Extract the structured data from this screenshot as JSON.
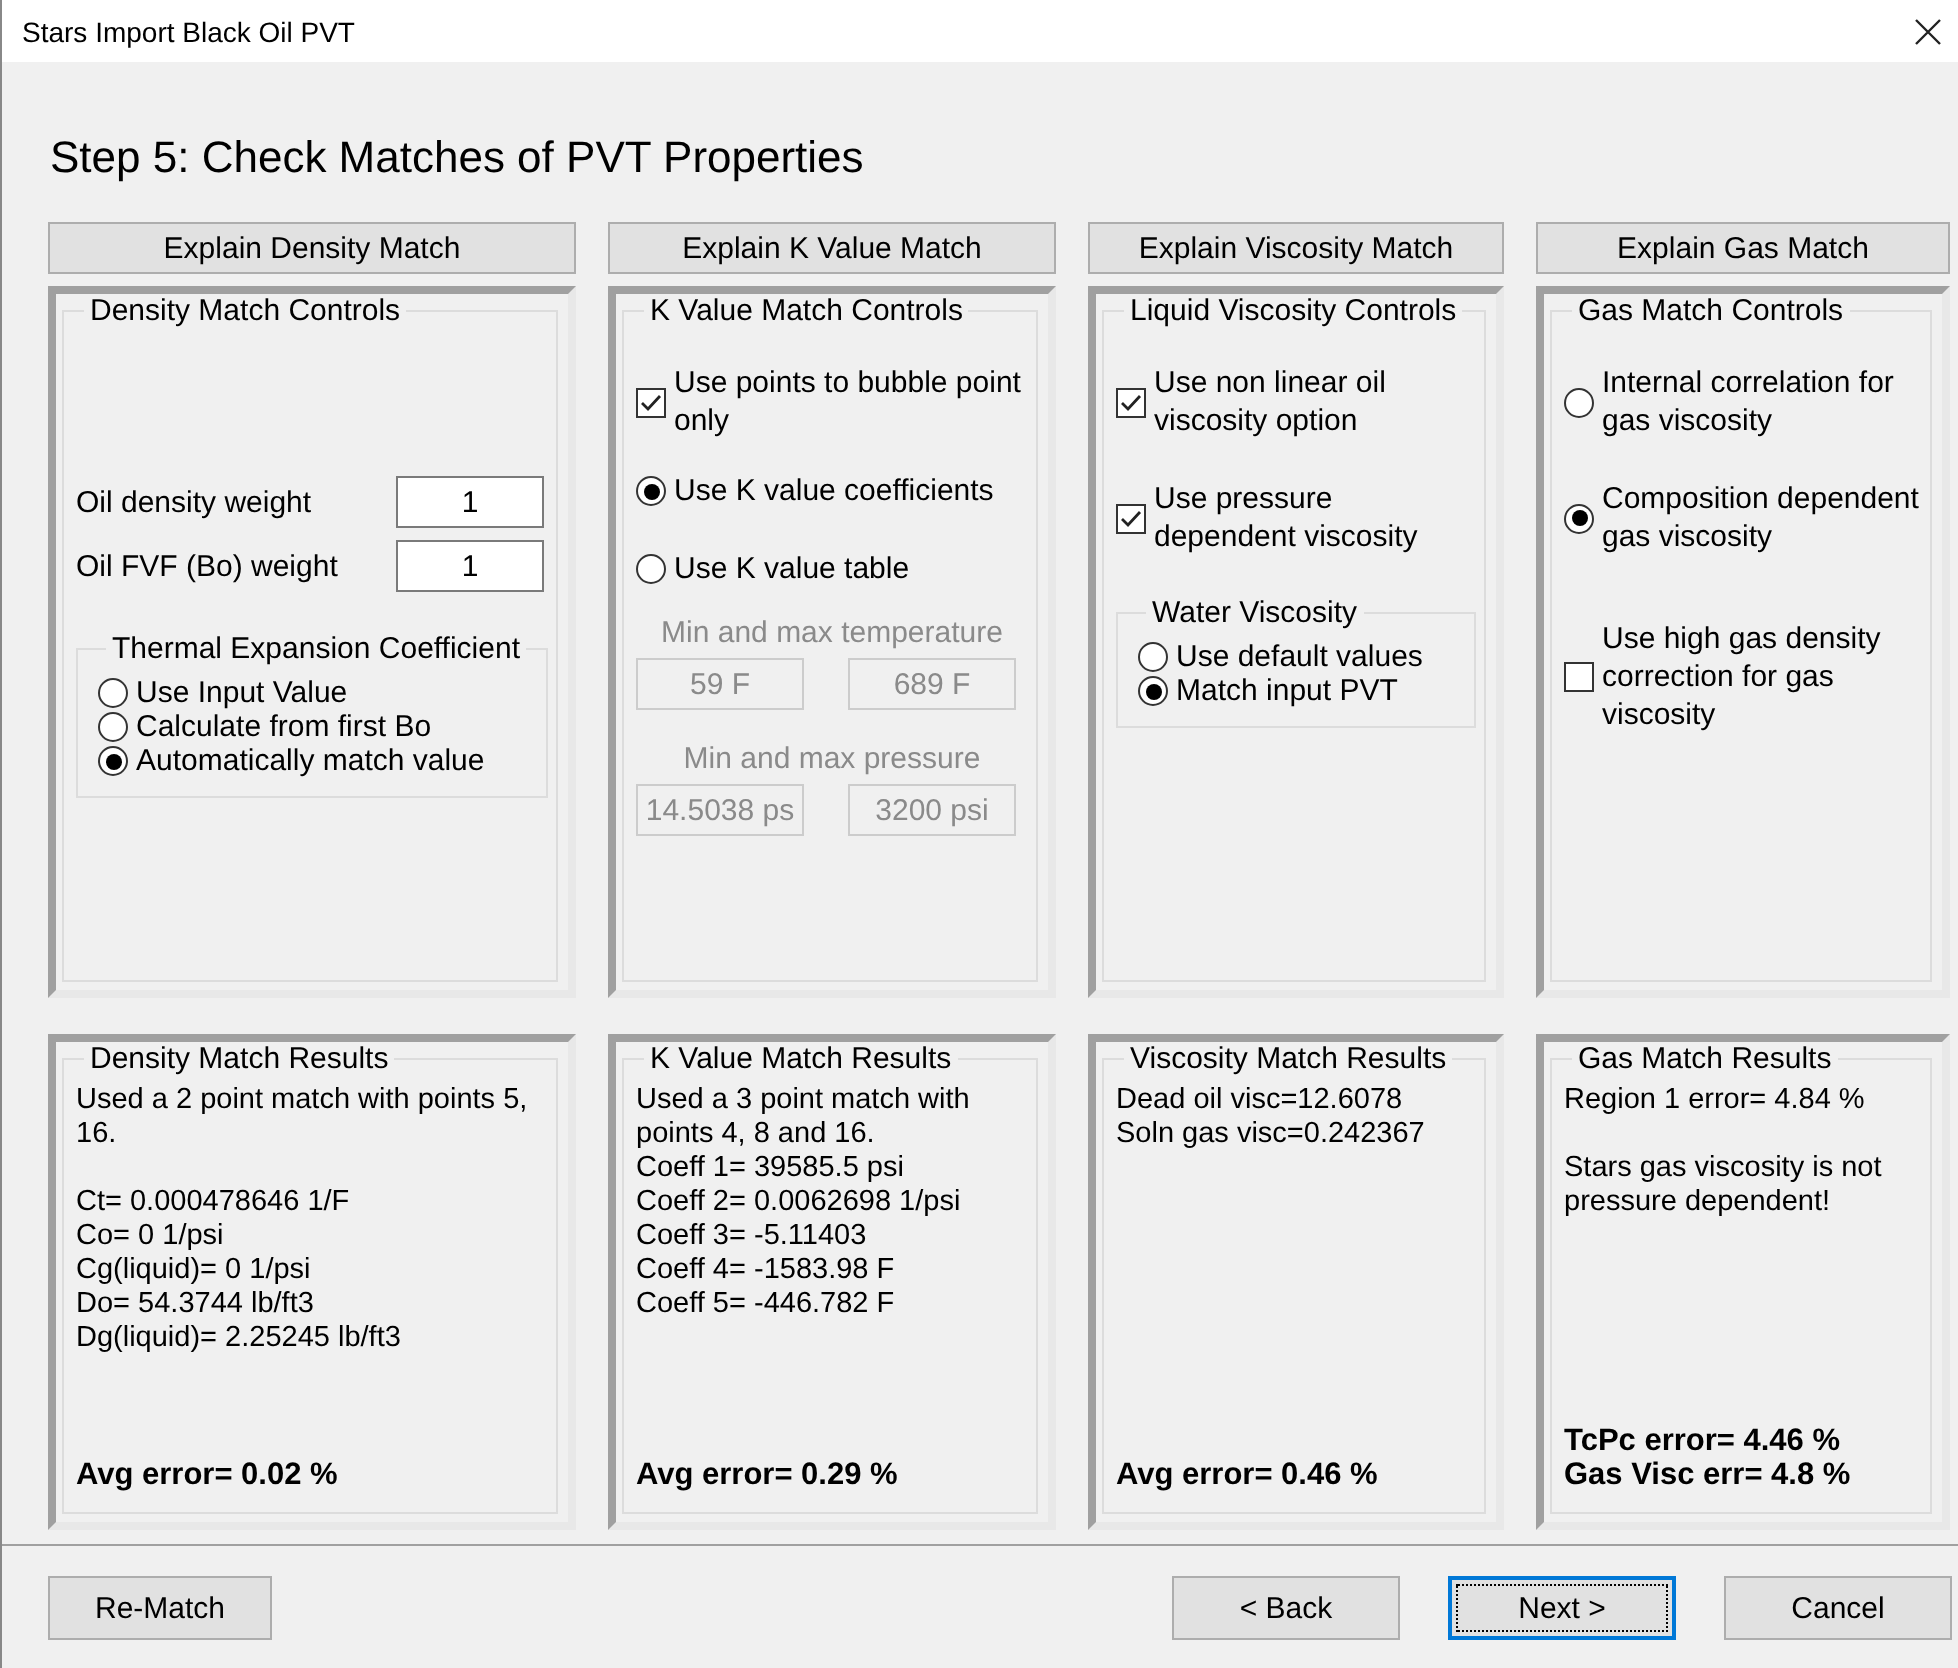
{
  "window": {
    "title": "Stars Import Black Oil PVT"
  },
  "heading": "Step 5: Check Matches of PVT Properties",
  "panels": [
    {
      "explain_button": {
        "label": "Explain Density Match"
      },
      "controls": {
        "title": "Density Match Controls",
        "items": [
          {
            "kind": "field",
            "label": "Oil density weight",
            "value": "1",
            "disabled": false
          },
          {
            "kind": "field",
            "label": "Oil FVF (Bo) weight",
            "value": "1",
            "disabled": false
          },
          {
            "kind": "group",
            "title": "Thermal Expansion Coefficient",
            "items": [
              {
                "kind": "radio",
                "label": "Use Input Value",
                "selected": false
              },
              {
                "kind": "radio",
                "label": "Calculate from first Bo",
                "selected": false
              },
              {
                "kind": "radio",
                "label": "Automatically match value",
                "selected": true
              }
            ]
          }
        ]
      },
      "results": {
        "title": "Density Match Results",
        "paragraphs": [
          [
            "Used a 2 point match with points 5, 16."
          ],
          [
            "Ct= 0.000478646 1/F",
            "Co= 0 1/psi",
            "Cg(liquid)= 0 1/psi",
            "Do= 54.3744 lb/ft3",
            "Dg(liquid)= 2.25245 lb/ft3"
          ]
        ],
        "summary": [
          "Avg error= 0.02 %"
        ]
      }
    },
    {
      "explain_button": {
        "label": "Explain K Value Match"
      },
      "controls": {
        "title": "K Value Match Controls",
        "items": [
          {
            "kind": "checkbox",
            "label": "Use points to bubble point only",
            "checked": true
          },
          {
            "kind": "radio",
            "label": "Use K value coefficients",
            "selected": true
          },
          {
            "kind": "radio",
            "label": "Use K value table",
            "selected": false
          },
          {
            "kind": "caption",
            "label": "Min and max temperature",
            "disabled": true
          },
          {
            "kind": "pair",
            "values": [
              "59 F",
              "689 F"
            ],
            "disabled": true
          },
          {
            "kind": "caption",
            "label": "Min and max pressure",
            "disabled": true
          },
          {
            "kind": "pair",
            "values": [
              "14.5038 ps",
              "3200 psi"
            ],
            "disabled": true
          }
        ]
      },
      "results": {
        "title": "K Value Match Results",
        "paragraphs": [
          [
            "Used a 3 point match with points 4, 8 and 16.",
            "Coeff 1= 39585.5 psi",
            "Coeff 2= 0.0062698 1/psi",
            "Coeff 3= -5.11403",
            "Coeff 4= -1583.98 F",
            "Coeff 5= -446.782 F"
          ]
        ],
        "summary": [
          "Avg error= 0.29 %"
        ]
      }
    },
    {
      "explain_button": {
        "label": "Explain Viscosity Match"
      },
      "controls": {
        "title": "Liquid Viscosity Controls",
        "items": [
          {
            "kind": "checkbox",
            "label": "Use non linear oil viscosity option",
            "checked": true
          },
          {
            "kind": "checkbox",
            "label": "Use pressure dependent viscosity",
            "checked": true
          },
          {
            "kind": "group",
            "title": "Water Viscosity",
            "items": [
              {
                "kind": "radio",
                "label": "Use default values",
                "selected": false
              },
              {
                "kind": "radio",
                "label": "Match input PVT",
                "selected": true
              }
            ]
          }
        ]
      },
      "results": {
        "title": "Viscosity Match Results",
        "paragraphs": [
          [
            "Dead oil visc=12.6078",
            "Soln gas visc=0.242367"
          ]
        ],
        "summary": [
          "Avg error= 0.46 %"
        ]
      }
    },
    {
      "explain_button": {
        "label": "Explain Gas Match"
      },
      "controls": {
        "title": "Gas Match Controls",
        "items": [
          {
            "kind": "radio",
            "label": "Internal correlation for gas viscosity",
            "selected": false
          },
          {
            "kind": "radio",
            "label": "Composition dependent gas viscosity",
            "selected": true
          },
          {
            "kind": "checkbox",
            "label": "Use high gas density correction for gas viscosity",
            "checked": false
          }
        ]
      },
      "results": {
        "title": "Gas Match Results",
        "paragraphs": [
          [
            "Region 1 error= 4.84 %"
          ],
          [
            "Stars gas viscosity is not pressure dependent!"
          ]
        ],
        "summary": [
          "TcPc error= 4.46 %",
          "Gas Visc err= 4.8 %"
        ]
      }
    }
  ],
  "rematch_button": {
    "label": "Re-Match",
    "default": false
  },
  "nav_buttons": [
    {
      "label": "< Back",
      "default": false
    },
    {
      "label": "Next >",
      "default": true
    },
    {
      "label": "Cancel",
      "default": false
    }
  ]
}
